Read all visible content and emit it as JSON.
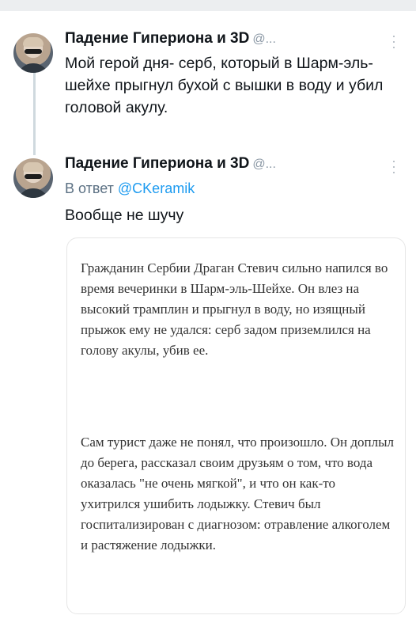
{
  "tweets": [
    {
      "author": "Падение Гипериона и 3D",
      "handle": "@...",
      "text": "Мой герой дня- серб, который в Шарм-эль-шейхе прыгнул бухой с вышки в воду и убил головой акулу."
    },
    {
      "author": "Падение Гипериона и 3D",
      "handle": "@...",
      "reply_prefix": "В ответ",
      "reply_handle": "@CKeramik",
      "text": "Вообще не шучу",
      "quote": {
        "paragraph1": "Гражданин Сербии Драган Стевич сильно напился во время вечеринки в Шарм-эль-Шейхе. Он влез на высокий трамплин и прыгнул в воду, но изящный прыжок ему не удался: серб задом приземлился на голову акулы, убив ее.",
        "paragraph2": "Сам турист даже не понял, что произошло. Он доплыл до берега, рассказал своим друзьям о том, что вода оказалась \"не очень мягкой\", и что он как-то ухитрился ушибить лодыжку. Стевич был госпитализирован с диагнозом: отравление алкоголем и растяжение лодыжки."
      }
    }
  ]
}
